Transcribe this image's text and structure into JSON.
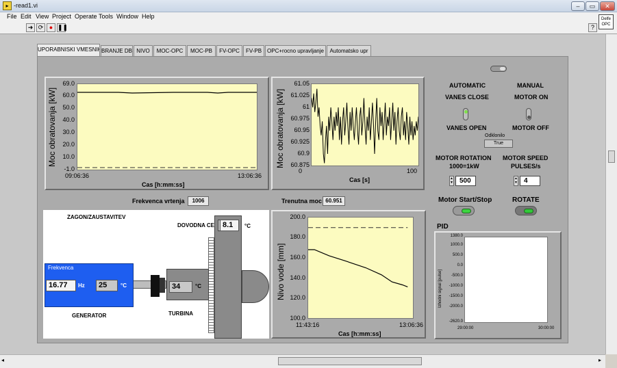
{
  "window": {
    "title": "-read1.vi",
    "app_icon": "labview-icon",
    "opc_badge_line1": "Delfe",
    "opc_badge_line2": "OPC"
  },
  "menu": [
    "File",
    "Edit",
    "View",
    "Project",
    "Operate",
    "Tools",
    "Window",
    "Help"
  ],
  "toolbar": {
    "run": "run-arrow-icon",
    "run_continuous": "run-continuous-icon",
    "abort": "abort-icon",
    "pause": "pause-icon",
    "help": "?"
  },
  "tabs": [
    "UPORABNISKI VMESNIK",
    "BRANJE DB",
    "NIVO",
    "MOC-OPC",
    "MOC-PB",
    "FV-OPC",
    "FV-PB",
    "OPC+rocno upravljanje",
    "Automatsko upr"
  ],
  "active_tab": 0,
  "power_graph": {
    "ylabel": "Moc obratovanja [kW]",
    "xlabel": "Cas [h:mm:ss]",
    "yticks": [
      "69.0",
      "60.0",
      "50.0",
      "40.0",
      "30.0",
      "20.0",
      "10.0",
      "-1.0"
    ],
    "xticks": [
      "09:06:36",
      "13:06:36"
    ]
  },
  "chart_data": [
    {
      "type": "line",
      "title": "",
      "xlabel": "Cas [s]",
      "ylabel": "Moc obratovanja [kW]",
      "ylim": [
        60.875,
        61.05
      ],
      "xlim": [
        0,
        100
      ],
      "yticks": [
        "61.05",
        "61.025",
        "61",
        "60.975",
        "60.95",
        "60.925",
        "60.9",
        "60.875"
      ],
      "xticks": [
        "0",
        "50",
        "100"
      ],
      "x": [
        0,
        1,
        2,
        3,
        4,
        5,
        6,
        7,
        8,
        9,
        10,
        11,
        12,
        13,
        14,
        15,
        16,
        17,
        18,
        19,
        20,
        21,
        22,
        23,
        24,
        25,
        26,
        27,
        28,
        29,
        30,
        31,
        32,
        33,
        34,
        35,
        36,
        37,
        38,
        39,
        40,
        41,
        42,
        43,
        44,
        45,
        46,
        47,
        48,
        49,
        50,
        51,
        52,
        53,
        54,
        55,
        56,
        57,
        58,
        59,
        60,
        61,
        62,
        63,
        64,
        65,
        66,
        67,
        68,
        69,
        70,
        71,
        72,
        73,
        74,
        75,
        76,
        77,
        78,
        79,
        80,
        81,
        82,
        83,
        84,
        85,
        86,
        87,
        88,
        89,
        90,
        91,
        92,
        93,
        94,
        95,
        96,
        97,
        98,
        99,
        100
      ],
      "values": [
        61.02,
        61.0,
        61.03,
        60.99,
        61.01,
        61.04,
        60.98,
        61.0,
        60.96,
        60.94,
        60.97,
        60.9,
        60.88,
        60.93,
        60.96,
        60.9,
        60.98,
        60.95,
        61.0,
        60.97,
        60.93,
        60.98,
        60.95,
        60.99,
        60.96,
        61.0,
        60.93,
        60.98,
        60.92,
        60.97,
        61.0,
        60.94,
        60.97,
        61.01,
        60.96,
        60.92,
        60.99,
        60.95,
        61.0,
        60.96,
        60.93,
        60.97,
        61.0,
        60.95,
        60.92,
        60.98,
        61.0,
        60.94,
        60.97,
        61.02,
        60.96,
        60.92,
        60.98,
        60.95,
        61.0,
        60.93,
        60.97,
        61.01,
        60.96,
        60.9,
        60.97,
        61.02,
        60.95,
        60.93,
        61.0,
        60.96,
        60.99,
        60.93,
        60.97,
        61.01,
        60.94,
        60.98,
        60.96,
        61.0,
        60.93,
        60.97,
        61.01,
        60.95,
        60.99,
        60.92,
        60.97,
        61.0,
        60.95,
        60.93,
        60.98,
        61.0,
        60.94,
        60.97,
        60.93,
        60.99,
        60.96,
        60.92,
        60.98,
        60.94,
        60.97,
        60.93,
        60.96,
        60.94,
        60.97,
        60.95,
        60.98
      ]
    },
    {
      "type": "line",
      "title": "",
      "xlabel": "Cas [h:mm:ss]",
      "ylabel": "Nivo vode [mm]",
      "ylim": [
        100,
        200
      ],
      "yticks": [
        "200.0",
        "180.0",
        "160.0",
        "140.0",
        "120.0",
        "100.0"
      ],
      "xticks": [
        "11:43:16",
        "13:06:36"
      ],
      "series": [
        {
          "x": [
            0,
            0.06,
            0.2,
            0.35,
            0.55,
            0.7,
            0.8,
            0.9,
            0.95
          ],
          "values": [
            168,
            168,
            162,
            157,
            150,
            143,
            136,
            133,
            131
          ]
        },
        {
          "x": [
            0,
            0.95
          ],
          "values": [
            190,
            190
          ]
        }
      ]
    }
  ],
  "frekvenca_vrtenja": {
    "label": "Frekvenca vrtenja",
    "value": "1006"
  },
  "trenutna_moc": {
    "label": "Trenutna moc",
    "value": "60.951"
  },
  "scheme": {
    "title": "ZAGON/ZAUSTAVITEV",
    "dovodna_cev_label": "DOVODNA CEV",
    "dovodna_cev_value": "8.1",
    "dovodna_cev_unit": "°C",
    "frekvenca_label": "Frekvenca",
    "frekvenca_value": "16.77",
    "frekvenca_unit": "Hz",
    "gen_temp_value": "25",
    "gen_temp_unit": "°C",
    "generator_label": "GENERATOR",
    "turbina_temp_value": "34",
    "turbina_temp_unit": "°C",
    "turbina_label": "TURBINA",
    "generator_color": "#1e5ef0"
  },
  "controls": {
    "automatic": "AUTOMATIC",
    "manual": "MANUAL",
    "vanes_close": "VANES CLOSE",
    "motor_on": "MOTOR ON",
    "vanes_open": "VANES OPEN",
    "motor_off": "MOTOR OFF",
    "odklonilo_label": "Odklonilo",
    "odklonilo_value": "True",
    "motor_rotation_line1": "MOTOR ROTATION",
    "motor_rotation_line2": "1000=1kW",
    "motor_rotation_value": "500",
    "motor_speed_line1": "MOTOR SPEED",
    "motor_speed_line2": "PULSES/s",
    "motor_speed_value": "4",
    "motor_start_stop": "Motor Start/Stop",
    "rotate": "ROTATE"
  },
  "pid": {
    "title": "PID",
    "ylabel": "Izhodni signal [pulse]",
    "yticks": [
      "1380.0",
      "1000.0",
      "500.0",
      "0.0",
      "-500.0",
      "-1000.0",
      "-1500.0",
      "-2000.0",
      "-2620.0"
    ],
    "xticks": [
      "29:00:00",
      "30:00:00"
    ]
  }
}
